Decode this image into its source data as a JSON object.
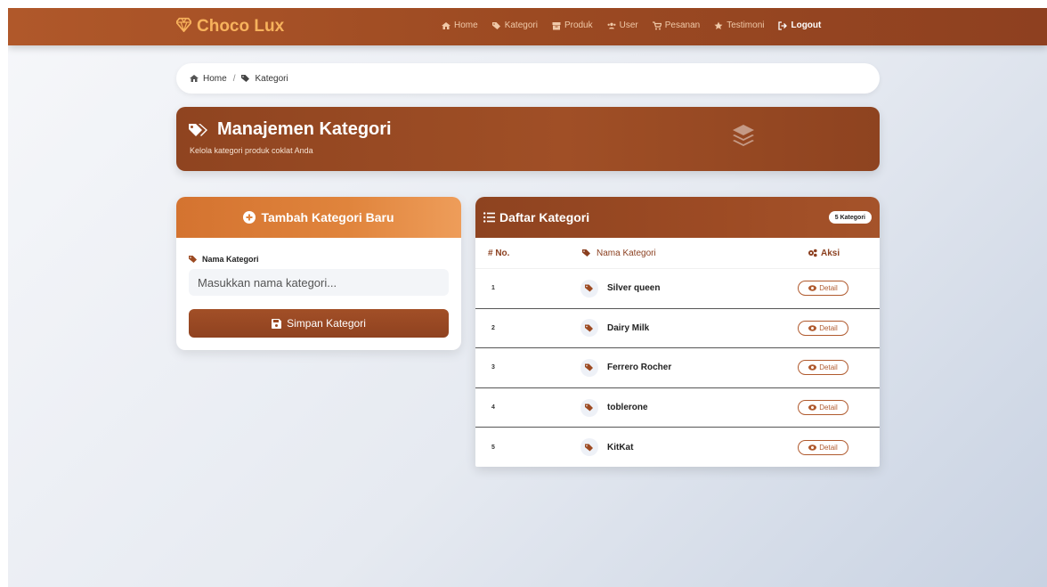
{
  "navbar": {
    "brand": "Choco Lux",
    "links": [
      {
        "label": "Home",
        "icon": "home-icon"
      },
      {
        "label": "Kategori",
        "icon": "tags-icon"
      },
      {
        "label": "Produk",
        "icon": "box-icon"
      },
      {
        "label": "User",
        "icon": "users-icon"
      },
      {
        "label": "Pesanan",
        "icon": "cart-icon"
      },
      {
        "label": "Testimoni",
        "icon": "star-icon"
      },
      {
        "label": "Logout",
        "icon": "logout-icon"
      }
    ]
  },
  "breadcrumb": {
    "home": "Home",
    "separator": "/",
    "current": "Kategori"
  },
  "banner": {
    "title": "Manajemen Kategori",
    "subtitle": "Kelola kategori produk coklat Anda"
  },
  "form": {
    "title": "Tambah Kategori Baru",
    "label": "Nama Kategori",
    "placeholder": "Masukkan nama kategori...",
    "value": "",
    "submit": "Simpan Kategori"
  },
  "list": {
    "title": "Daftar Kategori",
    "count_badge": "5 Kategori",
    "columns": {
      "no": "# No.",
      "name": "Nama Kategori",
      "action": "Aksi"
    },
    "rows": [
      {
        "no": "1",
        "name": "Silver queen",
        "action": "Detail"
      },
      {
        "no": "2",
        "name": "Dairy Milk",
        "action": "Detail"
      },
      {
        "no": "3",
        "name": "Ferrero Rocher",
        "action": "Detail"
      },
      {
        "no": "4",
        "name": "toblerone",
        "action": "Detail"
      },
      {
        "no": "5",
        "name": "KitKat",
        "action": "Detail"
      }
    ]
  },
  "colors": {
    "primary_brown": "#9c4a22",
    "accent_orange": "#e0843c",
    "brand_gold": "#f7b25c"
  }
}
